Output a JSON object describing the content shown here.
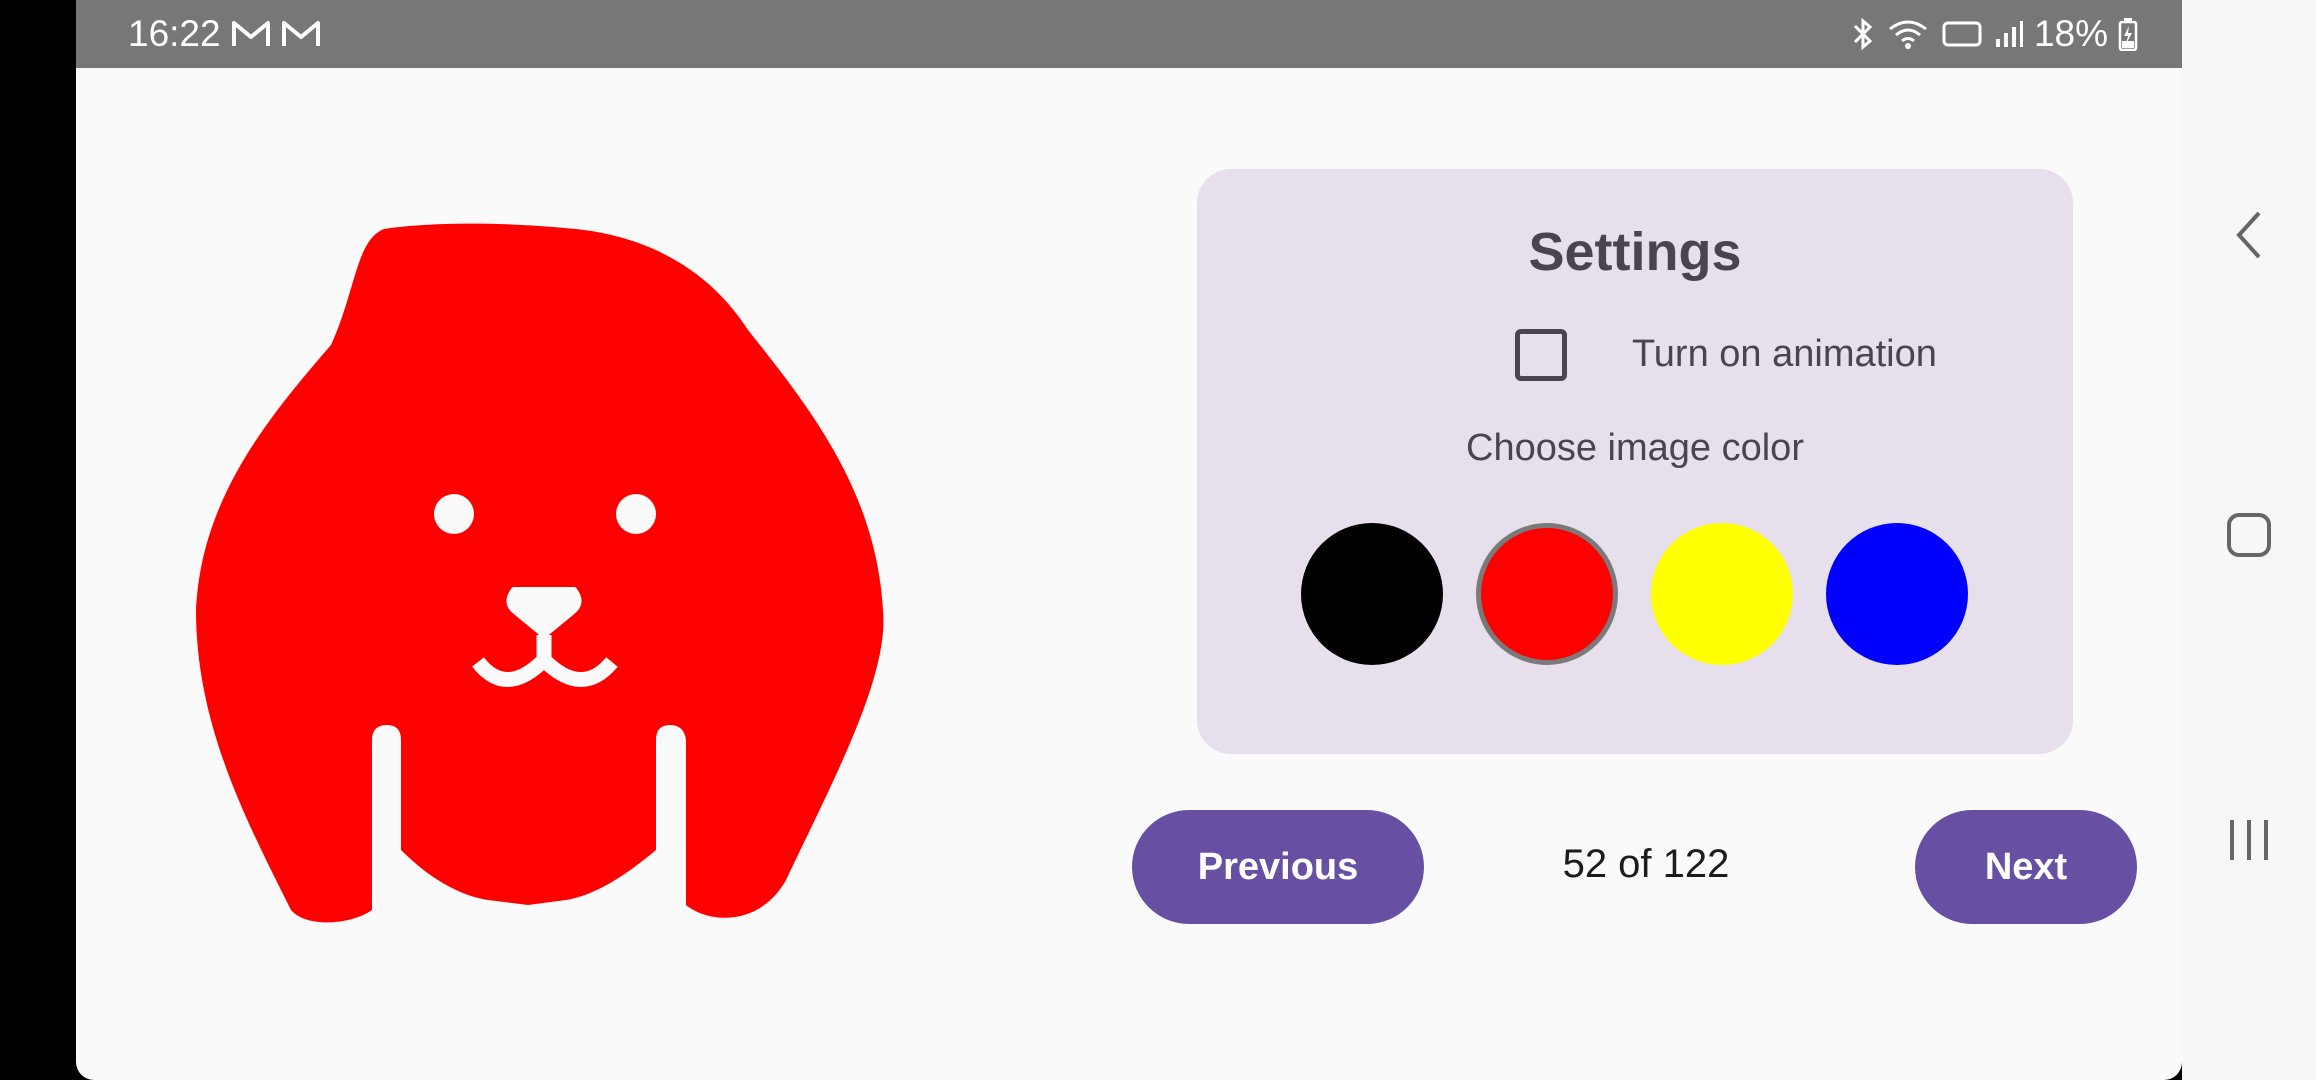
{
  "status_bar": {
    "time": "16:22",
    "battery": "18%",
    "icons": [
      "gmail-icon",
      "gmail-icon",
      "bluetooth-icon",
      "wifi-icon",
      "volte-icon",
      "signal-icon",
      "battery-charging-icon"
    ]
  },
  "main": {
    "image": {
      "icon": "dog-face-icon",
      "color": "#ff0000"
    }
  },
  "settings": {
    "title": "Settings",
    "animation_label": "Turn on animation",
    "animation_checked": false,
    "color_label": "Choose image color",
    "colors": [
      {
        "name": "black",
        "hex": "#000000",
        "selected": false
      },
      {
        "name": "red",
        "hex": "#ff0000",
        "selected": true
      },
      {
        "name": "yellow",
        "hex": "#ffff00",
        "selected": false
      },
      {
        "name": "blue",
        "hex": "#0000ff",
        "selected": false
      }
    ]
  },
  "pager": {
    "previous_label": "Previous",
    "counter": "52 of 122",
    "next_label": "Next"
  },
  "nav_bar": {
    "icons": [
      "back-icon",
      "home-icon",
      "recents-icon"
    ]
  }
}
